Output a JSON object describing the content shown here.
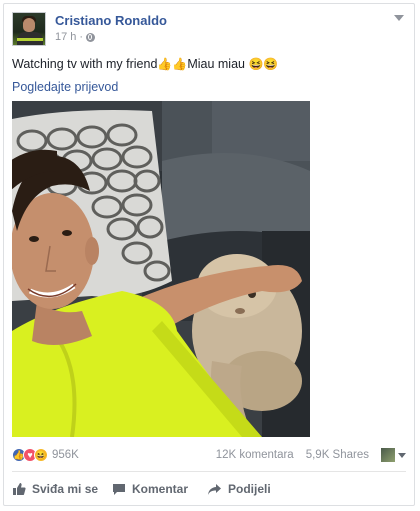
{
  "post": {
    "author": "Cristiano Ronaldo",
    "time": "17 h",
    "dot": "·",
    "text": "Watching tv with my friend",
    "text_after": "Miau miau",
    "translate_link": "Pogledajte prijevod"
  },
  "stats": {
    "reactions_count": "956K",
    "comments": "12K komentara",
    "shares": "5,9K Shares"
  },
  "actions": {
    "like": "Sviđa mi se",
    "comment": "Komentar",
    "share": "Podijeli"
  },
  "colors": {
    "link": "#365899",
    "like_blue": "#4267b2",
    "love_red": "#f25268",
    "haha_yellow": "#f7b928",
    "shirt_neon": "#d9f020"
  },
  "icons": [
    "globe-icon",
    "chevron-down-icon",
    "thumbs-up-emoji",
    "grinning-emoji",
    "like-icon",
    "comment-icon",
    "share-icon"
  ]
}
